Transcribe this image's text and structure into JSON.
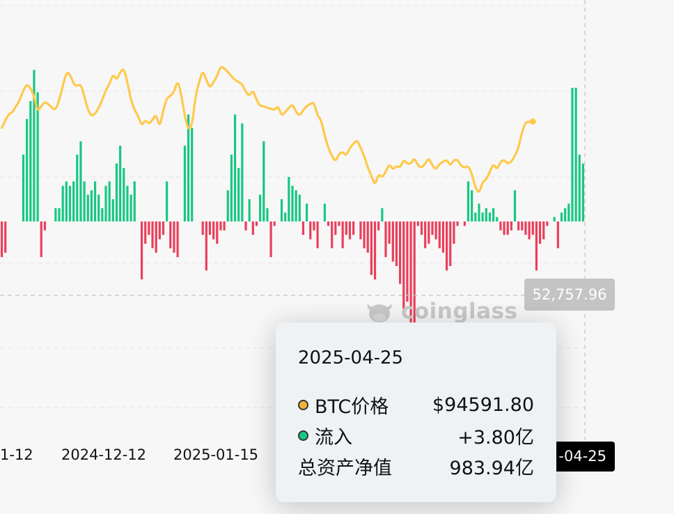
{
  "chart_data": {
    "type": "bar+line",
    "series": [
      {
        "name": "流入",
        "type": "bar",
        "axis": "flow",
        "positive_color": "#17c784",
        "negative_color": "#ea3f5b",
        "values": [
          -0.8,
          -0.7,
          0,
          0,
          0,
          0,
          1.5,
          2.3,
          2.7,
          3.4,
          2.9,
          -0.8,
          -0.2,
          0,
          0,
          0.3,
          0.3,
          0.8,
          0.9,
          0.8,
          0.9,
          1.5,
          1.8,
          0.9,
          0.6,
          0.7,
          0.9,
          0.6,
          0.3,
          0.8,
          0.9,
          0.5,
          1.3,
          1.7,
          1.2,
          0.8,
          0.6,
          0.9,
          0,
          -1.3,
          -0.5,
          -0.3,
          -0.6,
          -0.7,
          -0.4,
          -0.3,
          0.9,
          -0.6,
          -0.7,
          -0.8,
          0,
          1.7,
          2.4,
          2.1,
          0,
          0,
          -0.3,
          -1.1,
          -0.3,
          -0.4,
          -0.5,
          -0.2,
          -0.2,
          0.7,
          1.5,
          2.4,
          1.2,
          2.2,
          -0.2,
          0.5,
          -0.3,
          -0.1,
          0.6,
          1.8,
          0.3,
          -0.8,
          -0.1,
          0,
          0.5,
          0.2,
          1.0,
          0.8,
          0.7,
          0.6,
          -0.3,
          0.4,
          -0.4,
          -0.2,
          -0.6,
          0,
          0.4,
          -0.1,
          -0.6,
          -0.3,
          -0.1,
          -0.6,
          -0.3,
          -0.4,
          -0.3,
          0,
          -0.4,
          -0.6,
          -0.7,
          -1.2,
          -1.3,
          -0.2,
          0.3,
          -0.8,
          -0.5,
          -0.9,
          -1.0,
          -1.4,
          -2.1,
          -1.8,
          -2.4,
          -2.7,
          -0.1,
          -0.3,
          -0.6,
          -0.5,
          -0.3,
          -0.4,
          -0.6,
          -0.7,
          -1.1,
          -1.0,
          -0.5,
          -0.1,
          0,
          -0.1,
          0.9,
          0.7,
          0.2,
          0.4,
          0.2,
          0.3,
          0.2,
          0.3,
          0.1,
          -0.2,
          -0.3,
          -0.3,
          -0.2,
          0.7,
          -0.2,
          -0.2,
          -0.3,
          -0.4,
          -0.3,
          -1.1,
          -0.5,
          -0.4,
          -0.1,
          0,
          0.1,
          -0.6,
          0.2,
          0.3,
          0.4,
          3.0,
          3.0,
          1.5,
          1.3
        ]
      },
      {
        "name": "BTC价格",
        "type": "line",
        "axis": "price",
        "color": "#ffc94a",
        "values": [
          93000,
          95000,
          96500,
          97000,
          98500,
          100000,
          102500,
          104000,
          103000,
          101000,
          97000,
          98500,
          99500,
          99000,
          98000,
          97500,
          100000,
          103500,
          107000,
          106500,
          104000,
          103500,
          104000,
          101000,
          97500,
          96000,
          96500,
          98000,
          100000,
          102500,
          104000,
          106500,
          105000,
          107000,
          108000,
          104500,
          100000,
          97500,
          96000,
          93500,
          95000,
          94000,
          95000,
          96500,
          93000,
          97500,
          100500,
          101000,
          102000,
          105000,
          101500,
          96000,
          92500,
          93500,
          101000,
          104500,
          107500,
          105000,
          103000,
          104500,
          106000,
          108500,
          108000,
          107000,
          106000,
          105000,
          104500,
          104000,
          102000,
          101000,
          102500,
          100000,
          98500,
          98500,
          98000,
          97800,
          97500,
          98500,
          96000,
          97000,
          98000,
          99000,
          97000,
          96000,
          97500,
          98500,
          99000,
          99500,
          96000,
          95000,
          91000,
          88000,
          86000,
          84500,
          86500,
          87000,
          86000,
          88000,
          89000,
          90000,
          88000,
          86000,
          83000,
          81000,
          78500,
          81500,
          80500,
          82000,
          84000,
          82500,
          83500,
          83000,
          85000,
          84000,
          84000,
          85500,
          83500,
          83000,
          84000,
          85500,
          83500,
          82500,
          84000,
          84500,
          85000,
          83500,
          85000,
          85000,
          83500,
          83000,
          83500,
          81500,
          78000,
          76500,
          79500,
          80000,
          82000,
          84000,
          82500,
          84500,
          85000,
          84000,
          84500,
          86000,
          88000,
          92000,
          94500,
          94500,
          94591.8
        ]
      }
    ],
    "x_tick_labels": [
      "1-12",
      "2024-12-12",
      "2025-01-15"
    ],
    "highlighted_point": {
      "date": "2025-04-25",
      "price_label": "BTC价格",
      "price_value": "$94591.80",
      "flow_label": "流入",
      "flow_value": "+3.80亿",
      "nav_label": "总资产净值",
      "nav_value": "983.94亿"
    },
    "crosshair_y_label": "52,757.96",
    "crosshair_x_label": "-04-25",
    "grid": true,
    "colors": {
      "positive": "#17c784",
      "negative": "#ea3f5b",
      "line": "#ffc94a"
    }
  },
  "watermark": {
    "text": "coinglass",
    "icon": "cow-head-icon"
  }
}
